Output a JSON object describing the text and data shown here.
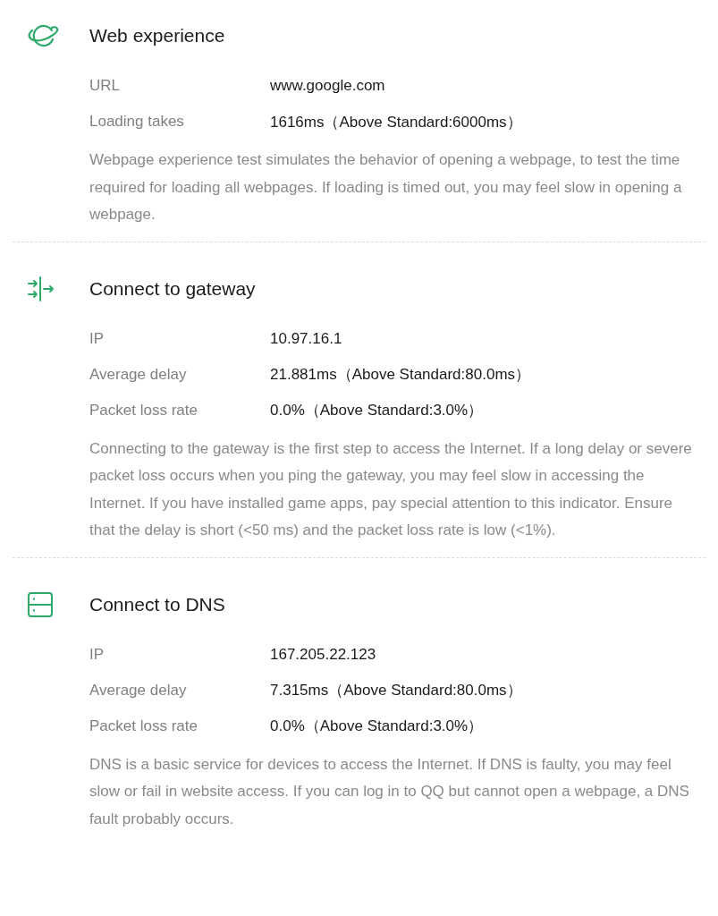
{
  "sections": [
    {
      "kind": "web",
      "title": "Web experience",
      "rows": [
        {
          "label": "URL",
          "value": "www.google.com"
        },
        {
          "label": "Loading takes",
          "value": "1616ms（Above Standard:6000ms）"
        }
      ],
      "description": "Webpage experience test simulates the behavior of opening a webpage, to test the time required for loading all webpages. If loading is timed out, you may feel slow in opening a webpage."
    },
    {
      "kind": "gateway",
      "title": "Connect to gateway",
      "rows": [
        {
          "label": "IP",
          "value": "10.97.16.1"
        },
        {
          "label": "Average delay",
          "value": "21.881ms（Above Standard:80.0ms）"
        },
        {
          "label": "Packet loss rate",
          "value": "0.0%（Above Standard:3.0%）"
        }
      ],
      "description": "Connecting to the gateway is the first step to access the Internet. If a long delay or severe packet loss occurs when you ping the gateway, you may feel slow in accessing the Internet. If you have installed game apps, pay special attention to this indicator. Ensure that the delay is short (<50 ms) and the packet loss rate is low (<1%)."
    },
    {
      "kind": "dns",
      "title": "Connect to DNS",
      "rows": [
        {
          "label": "IP",
          "value": "167.205.22.123"
        },
        {
          "label": "Average delay",
          "value": "7.315ms（Above Standard:80.0ms）"
        },
        {
          "label": "Packet loss rate",
          "value": "0.0%（Above Standard:3.0%）"
        }
      ],
      "description": "DNS is a basic service for devices to access the Internet. If DNS is faulty, you may feel slow or fail in website access. If you can log in to QQ but cannot open a webpage, a DNS fault probably occurs."
    }
  ]
}
